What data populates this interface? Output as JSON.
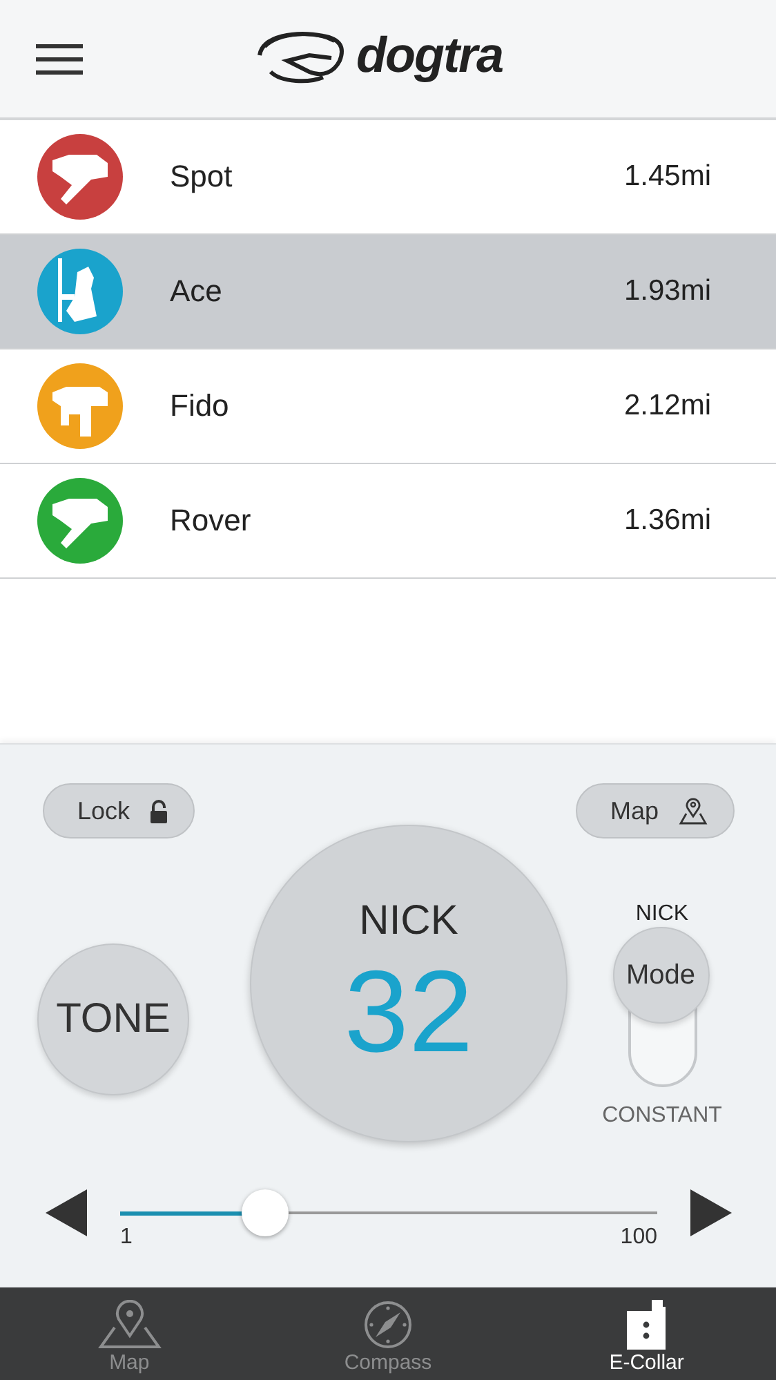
{
  "header": {
    "logo_text": "dogtra"
  },
  "dogs": [
    {
      "name": "Spot",
      "distance": "1.45mi",
      "color": "#c8403f",
      "kind": "pointer",
      "selected": false
    },
    {
      "name": "Ace",
      "distance": "1.93mi",
      "color": "#1aa3cc",
      "kind": "sitting",
      "selected": true
    },
    {
      "name": "Fido",
      "distance": "2.12mi",
      "color": "#f0a11c",
      "kind": "standing",
      "selected": false
    },
    {
      "name": "Rover",
      "distance": "1.36mi",
      "color": "#2aaa3b",
      "kind": "pointer",
      "selected": false
    }
  ],
  "controls": {
    "lock": {
      "label": "Lock",
      "locked": false
    },
    "map": {
      "label": "Map"
    },
    "tone": "TONE",
    "mode_label": "NICK",
    "level_value": "32",
    "mode": {
      "button": "Mode",
      "options": [
        {
          "label": "NICK",
          "selected": true
        },
        {
          "label": "CONSTANT",
          "selected": false
        }
      ]
    },
    "slider": {
      "level": 0.27,
      "min": "1",
      "max": "100"
    }
  },
  "tabs": [
    {
      "label": "Map",
      "selected": false,
      "kind": "map"
    },
    {
      "label": "Compass",
      "selected": false,
      "kind": "compass"
    },
    {
      "label": "E-Collar",
      "selected": true,
      "kind": "collar"
    }
  ]
}
